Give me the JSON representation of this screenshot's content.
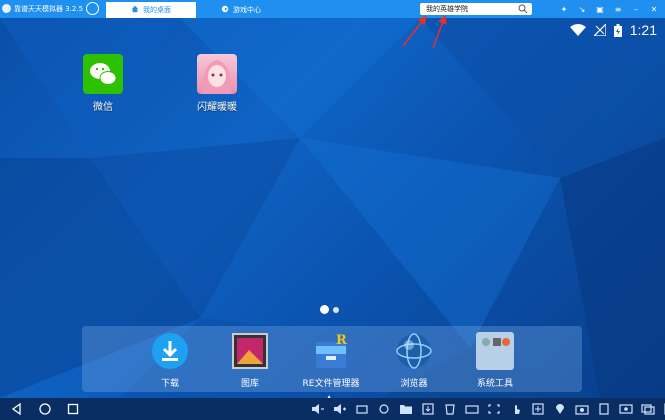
{
  "titlebar": {
    "app_title": "靠谱天天模拟器 3.2.5",
    "tabs": [
      {
        "label": "我的桌面",
        "active": true
      },
      {
        "label": "游戏中心",
        "active": false
      }
    ],
    "search": {
      "value": "我的英雄学院"
    }
  },
  "status": {
    "time": "1:21"
  },
  "desktop": {
    "apps": [
      {
        "label": "微信",
        "icon": "wechat-icon"
      },
      {
        "label": "闪耀暖暖",
        "icon": "game-girl-icon"
      }
    ],
    "page_count": 2,
    "active_page": 1
  },
  "dock": {
    "items": [
      {
        "label": "下载",
        "icon": "download-icon"
      },
      {
        "label": "图库",
        "icon": "gallery-icon"
      },
      {
        "label": "RE文件管理器",
        "icon": "file-manager-icon"
      },
      {
        "label": "浏览器",
        "icon": "browser-icon"
      },
      {
        "label": "系统工具",
        "icon": "system-tools-icon"
      }
    ]
  },
  "colors": {
    "titlebar": "#1f8ff0",
    "navbar": "#0a2d63",
    "annotation": "#e8302a"
  }
}
